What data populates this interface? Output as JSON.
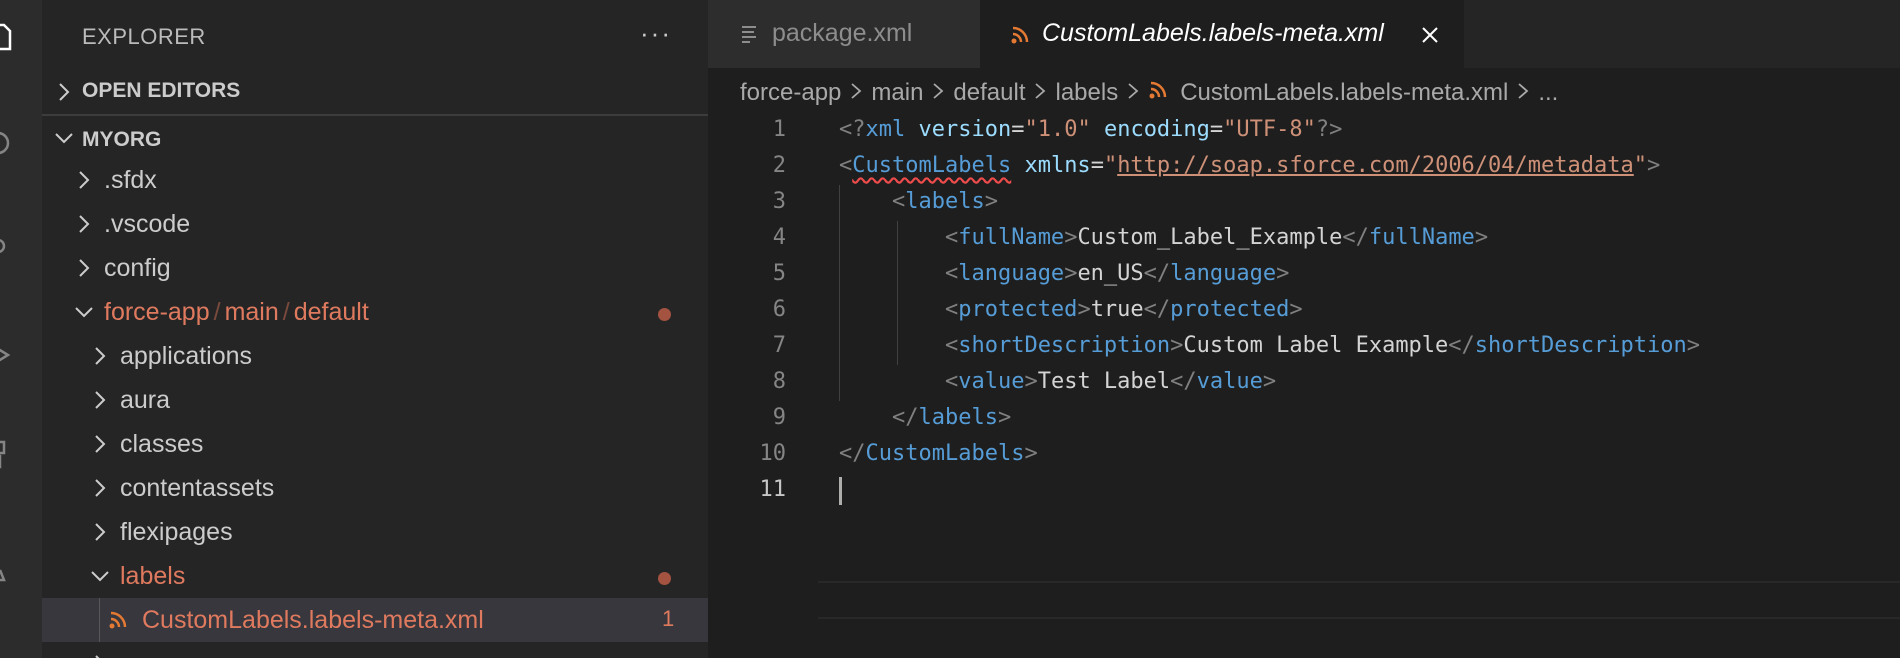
{
  "sidebar": {
    "title": "EXPLORER",
    "more_label": "···",
    "open_editors": "OPEN EDITORS",
    "workspace": "MYORG",
    "tree": [
      {
        "label": ".sfdx"
      },
      {
        "label": ".vscode"
      },
      {
        "label": "config"
      },
      {
        "label": "force-app",
        "sep1": "/",
        "mid": "main",
        "sep2": "/",
        "end": "default"
      },
      {
        "label": "applications"
      },
      {
        "label": "aura"
      },
      {
        "label": "classes"
      },
      {
        "label": "contentassets"
      },
      {
        "label": "flexipages"
      },
      {
        "label": "labels"
      },
      {
        "label": "CustomLabels.labels-meta.xml",
        "badge": "1"
      }
    ]
  },
  "tabs": [
    {
      "label": "package.xml"
    },
    {
      "label": "CustomLabels.labels-meta.xml"
    }
  ],
  "breadcrumb": [
    "force-app",
    "main",
    "default",
    "labels",
    "CustomLabels.labels-meta.xml",
    "..."
  ],
  "editor": {
    "line_numbers": [
      "1",
      "2",
      "3",
      "4",
      "5",
      "6",
      "7",
      "8",
      "9",
      "10",
      "11"
    ],
    "lines": [
      {
        "indent": "",
        "tag": "xml",
        "attr1": "version",
        "val1": "\"1.0\"",
        "attr2": "encoding",
        "val2": "\"UTF-8\""
      },
      {
        "indent": "",
        "tag": "CustomLabels",
        "attr": "xmlns",
        "eq": "=",
        "q1": "\"",
        "url": "http://soap.sforce.com/2006/04/metadata",
        "q2": "\""
      },
      {
        "indent": "    ",
        "tag": "labels"
      },
      {
        "indent": "        ",
        "tag": "fullName",
        "text": "Custom_Label_Example"
      },
      {
        "indent": "        ",
        "tag": "language",
        "text": "en_US"
      },
      {
        "indent": "        ",
        "tag": "protected",
        "text": "true"
      },
      {
        "indent": "        ",
        "tag": "shortDescription",
        "text": "Custom Label Example"
      },
      {
        "indent": "        ",
        "tag": "value",
        "text": "Test Label"
      },
      {
        "indent": "    ",
        "tag": "labels"
      },
      {
        "indent": "",
        "tag": "CustomLabels"
      },
      {
        "indent": ""
      }
    ]
  },
  "colors": {
    "modified": "#e07a5f",
    "xml_tag": "#569cd6",
    "xml_attr": "#9cdcfe",
    "xml_string": "#ce9178"
  },
  "icons": [
    "files-icon",
    "search-icon",
    "source-control-icon",
    "run-debug-icon",
    "extensions-icon",
    "test-icon",
    "rss-xml-icon",
    "lines-file-icon",
    "close-icon",
    "chevron-right-icon",
    "chevron-down-icon"
  ]
}
